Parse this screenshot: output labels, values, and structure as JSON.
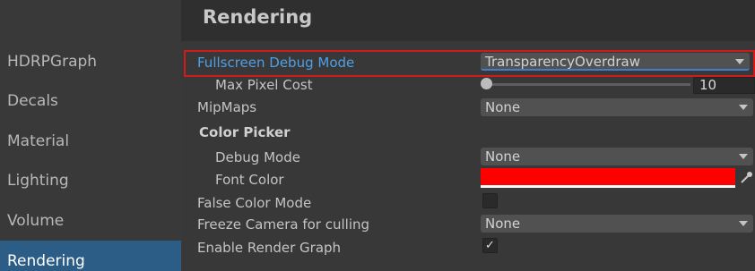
{
  "sidebar": {
    "items": [
      {
        "label": "HDRPGraph"
      },
      {
        "label": "Decals"
      },
      {
        "label": "Material"
      },
      {
        "label": "Lighting"
      },
      {
        "label": "Volume"
      },
      {
        "label": "Rendering"
      }
    ],
    "selected": "Rendering"
  },
  "panel": {
    "title": "Rendering",
    "fullscreen_debug_mode": {
      "label": "Fullscreen Debug Mode",
      "value": "TransparencyOverdraw"
    },
    "max_pixel_cost": {
      "label": "Max Pixel Cost",
      "value": "10",
      "slider_fraction": 0.0
    },
    "mipmaps": {
      "label": "MipMaps",
      "value": "None"
    },
    "color_picker": {
      "heading": "Color Picker",
      "debug_mode": {
        "label": "Debug Mode",
        "value": "None"
      },
      "font_color": {
        "label": "Font Color",
        "color": "#ff0000"
      }
    },
    "false_color_mode": {
      "label": "False Color Mode",
      "checked": false
    },
    "freeze_camera": {
      "label": "Freeze Camera for culling",
      "value": "None"
    },
    "enable_render_graph": {
      "label": "Enable Render Graph",
      "checked": true,
      "check_glyph": "✓"
    }
  },
  "colors": {
    "highlight_border": "#d11a1a",
    "selected_item_bg": "#2c5d87",
    "highlighted_label": "#4ea0e6"
  }
}
